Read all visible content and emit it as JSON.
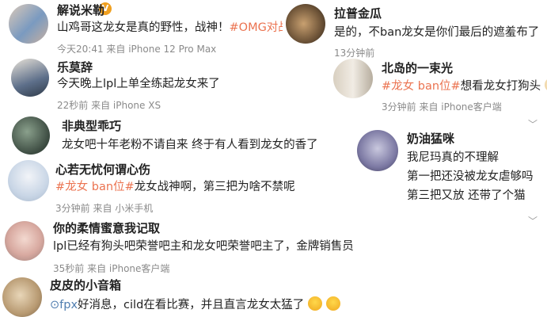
{
  "comments_left": [
    {
      "name": "解说米勒",
      "text": "山鸡哥这龙女是真的野性，战神！",
      "tag": "#OMG对战",
      "meta": "今天20:41  来自 iPhone 12 Pro Max"
    },
    {
      "name": "乐莫辞",
      "text": "今天晚上lpl上单全练起龙女来了",
      "meta": "22秒前  来自 iPhone XS"
    },
    {
      "name": "非典型乖巧",
      "text": "龙女吧十年老粉不请自来 终于有人看到龙女的香了"
    },
    {
      "name": "心若无忧何谓心伤",
      "tag": "#龙女 ban位#",
      "text": "龙女战神啊，第三把为啥不禁呢",
      "meta": "3分钟前  来自 小米手机"
    },
    {
      "name": "你的柔情蜜意我记取",
      "text": "lpl已经有狗头吧荣誉吧主和龙女吧荣誉吧主了，金牌销售员",
      "meta": "35秒前  来自 iPhone客户端"
    },
    {
      "name": "皮皮的小音箱",
      "link": "fpx",
      "text": "好消息，cild在看比赛，并且直言龙女太猛了"
    }
  ],
  "comments_right": [
    {
      "name": "拉普金瓜",
      "text": "是的，不ban龙女是你们最后的遮羞布了",
      "meta": "13分钟前"
    },
    {
      "name": "北岛的一束光",
      "tag": "#龙女 ban位#",
      "text": "想看龙女打狗头",
      "meta": "3分钟前  来自 iPhone客户端"
    },
    {
      "name": "奶油猛咪",
      "lines": [
        "我尼玛真的不理解",
        "第一把还没被龙女虐够吗",
        "第三把又放 还带了个猫"
      ]
    }
  ],
  "colors": {
    "topic": "#eb7350",
    "link": "#507daf",
    "meta": "#8a8a8a",
    "verified_badge": "#f0a020"
  },
  "icons": {
    "verified": "verified-badge-icon",
    "expand": "chevron-down-icon",
    "link": "link-icon",
    "emoji": "crying-face-emoji-icon"
  }
}
